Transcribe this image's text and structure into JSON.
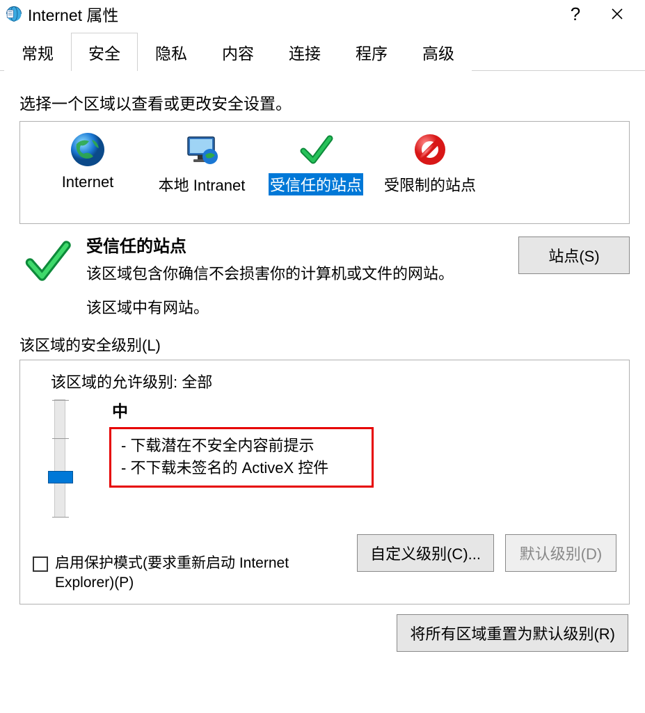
{
  "title": "Internet 属性",
  "tabs": [
    "常规",
    "安全",
    "隐私",
    "内容",
    "连接",
    "程序",
    "高级"
  ],
  "active_tab_index": 1,
  "zone_instruction": "选择一个区域以查看或更改安全设置。",
  "zones": [
    {
      "id": "internet",
      "label": "Internet"
    },
    {
      "id": "intranet",
      "label": "本地 Intranet"
    },
    {
      "id": "trusted",
      "label": "受信任的站点"
    },
    {
      "id": "restricted",
      "label": "受限制的站点"
    }
  ],
  "selected_zone_index": 2,
  "zone_detail": {
    "title": "受信任的站点",
    "description": "该区域包含你确信不会损害你的计算机或文件的网站。",
    "status": "该区域中有网站。"
  },
  "sites_button": "站点(S)",
  "security_level_label": "该区域的安全级别(L)",
  "allowed_levels_label": "该区域的允许级别: 全部",
  "current_level_name": "中",
  "level_bullets": [
    "下载潜在不安全内容前提示",
    "不下载未签名的 ActiveX 控件"
  ],
  "protected_mode_label": "启用保护模式(要求重新启动 Internet Explorer)(P)",
  "custom_level_button": "自定义级别(C)...",
  "default_level_button": "默认级别(D)",
  "reset_all_button": "将所有区域重置为默认级别(R)"
}
